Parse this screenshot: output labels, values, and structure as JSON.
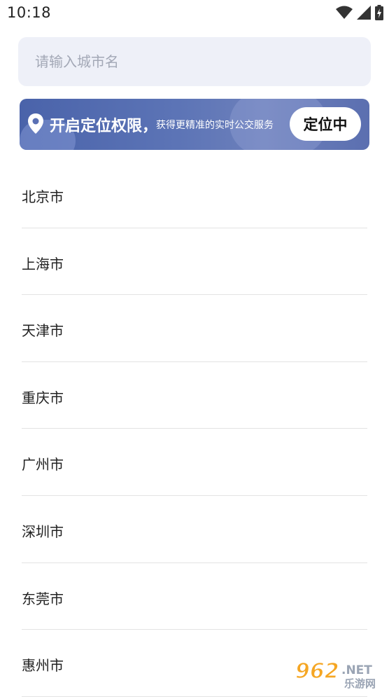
{
  "status_bar": {
    "time": "10:18",
    "icons": [
      "wifi-icon",
      "signal-icon",
      "battery-charging-icon"
    ]
  },
  "search": {
    "placeholder": "请输入城市名",
    "value": ""
  },
  "location_banner": {
    "title": "开启定位权限，",
    "subtitle": "获得更精准的实时公交服务",
    "button_label": "定位中",
    "icon": "location-pin-icon",
    "colors": {
      "gradient_start": "#4a63aa",
      "gradient_end": "#6d80bb"
    }
  },
  "cities": [
    {
      "name": "北京市"
    },
    {
      "name": "上海市"
    },
    {
      "name": "天津市"
    },
    {
      "name": "重庆市"
    },
    {
      "name": "广州市"
    },
    {
      "name": "深圳市"
    },
    {
      "name": "东莞市"
    },
    {
      "name": "惠州市"
    }
  ],
  "watermark": {
    "number": "962",
    "suffix": ".NET",
    "cn": "乐游网"
  }
}
